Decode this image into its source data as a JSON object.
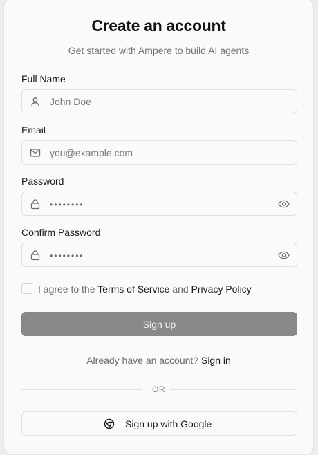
{
  "header": {
    "title": "Create an account",
    "subtitle": "Get started with Ampere to build AI agents"
  },
  "form": {
    "full_name": {
      "label": "Full Name",
      "placeholder": "John Doe",
      "icon": "user-icon"
    },
    "email": {
      "label": "Email",
      "placeholder": "you@example.com",
      "icon": "mail-icon"
    },
    "password": {
      "label": "Password",
      "placeholder": "••••••••",
      "icon": "lock-icon",
      "toggle_icon": "eye-icon"
    },
    "confirm_password": {
      "label": "Confirm Password",
      "placeholder": "••••••••",
      "icon": "lock-icon",
      "toggle_icon": "eye-icon"
    },
    "terms": {
      "prefix": "I agree to the",
      "terms_link": "Terms of Service",
      "and": "and",
      "privacy_link": "Privacy Policy",
      "checked": false
    },
    "submit_label": "Sign up"
  },
  "footer": {
    "have_account_text": "Already have an account?",
    "sign_in_link": "Sign in",
    "divider_text": "OR",
    "google_button_label": "Sign up with Google",
    "google_icon": "chrome-icon"
  },
  "colors": {
    "background": "#ededed",
    "card": "#fafafa",
    "primary_button": "#888888",
    "border": "#dedede",
    "muted_text": "#737373"
  }
}
